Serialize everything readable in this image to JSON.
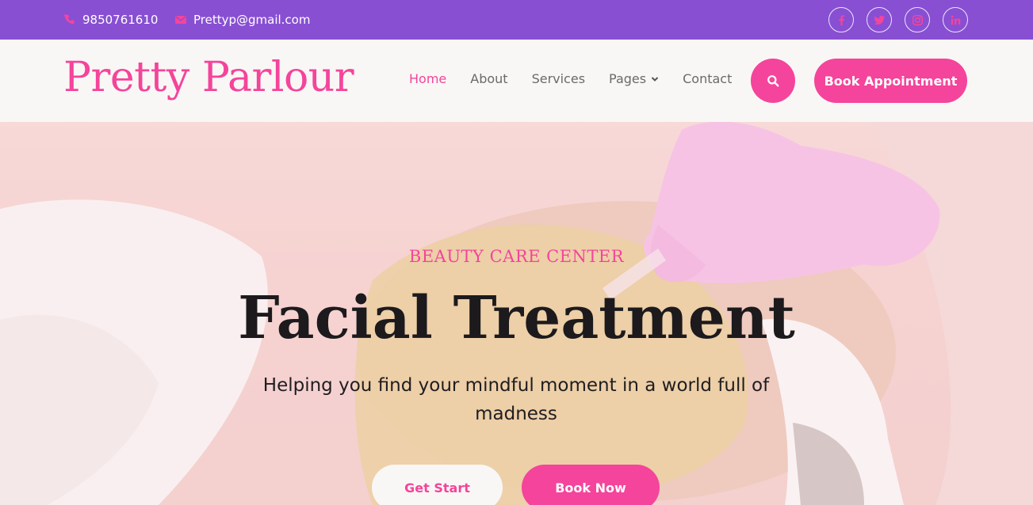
{
  "topbar": {
    "phone": "9850761610",
    "email": "Prettyp@gmail.com",
    "phone_icon": "phone-icon",
    "email_icon": "envelope-icon",
    "socials": [
      "facebook-icon",
      "twitter-icon",
      "instagram-icon",
      "linkedin-icon"
    ],
    "color": "#884fd3"
  },
  "nav": {
    "logo": "Pretty Parlour",
    "links": [
      "Home",
      "About",
      "Services",
      "Pages",
      "Contact"
    ],
    "active": "Home",
    "search_icon": "search-icon",
    "book_appointment": "Book Appointment",
    "accent": "#f5449b"
  },
  "hero": {
    "eyebrow": "BEAUTY CARE CENTER",
    "title": "Facial Treatment",
    "subtitle": "Helping you find your mindful moment in a world full of madness",
    "get_start": "Get Start",
    "book_now": "Book Now"
  }
}
